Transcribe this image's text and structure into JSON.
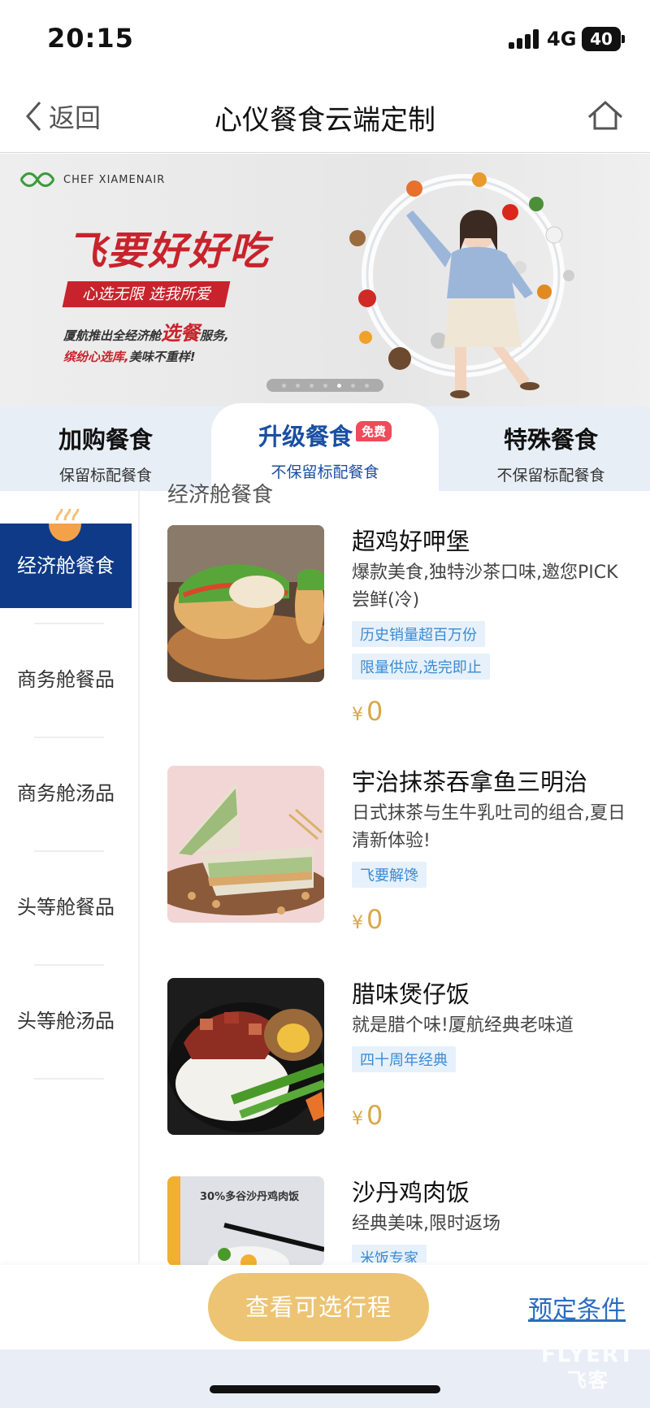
{
  "status_bar": {
    "time": "20:15",
    "network": "4G",
    "battery": "40"
  },
  "nav": {
    "back_label": "返回",
    "title": "心仪餐食云端定制"
  },
  "banner": {
    "brand": "CHEF XIAMENAIR",
    "slogan": "飞要好好吃",
    "ribbon": "心选无限 选我所爱",
    "promo_line1_prefix": "厦航推出全经济舱",
    "promo_line1_highlight": "选餐",
    "promo_line1_suffix": "服务,",
    "promo_line2_highlight": "缤纷心选库,",
    "promo_line2_suffix": "美味不重样!",
    "active_slide": 5,
    "slide_count": 7
  },
  "tabs": [
    {
      "title": "加购餐食",
      "subtitle": "保留标配餐食"
    },
    {
      "title": "升级餐食",
      "subtitle": "不保留标配餐食",
      "badge": "免费"
    },
    {
      "title": "特殊餐食",
      "subtitle": "不保留标配餐食"
    }
  ],
  "sidebar": {
    "items": [
      "经济舱餐食",
      "商务舱餐品",
      "商务舱汤品",
      "头等舱餐品",
      "头等舱汤品"
    ]
  },
  "section_title": "经济舱餐食",
  "items": [
    {
      "name": "超鸡好呷堡",
      "desc": "爆款美食,独特沙茶口味,邀您PICK尝鲜(冷)",
      "tags": [
        "历史销量超百万份",
        "限量供应,选完即止"
      ],
      "currency": "¥",
      "price": "0"
    },
    {
      "name": "宇治抹茶吞拿鱼三明治",
      "desc": "日式抹茶与生牛乳吐司的组合,夏日清新体验!",
      "tags": [
        "飞要解馋"
      ],
      "currency": "¥",
      "price": "0"
    },
    {
      "name": "腊味煲仔饭",
      "desc": "就是腊个味!厦航经典老味道",
      "tags": [
        "四十周年经典"
      ],
      "currency": "¥",
      "price": "0"
    },
    {
      "name": "沙丹鸡肉饭",
      "desc": "经典美味,限时返场",
      "tags": [
        "米饭专家"
      ],
      "image_text": "30%多谷沙丹鸡肉饭"
    }
  ],
  "bottom": {
    "primary_button": "查看可选行程",
    "condition_link": "预定条件"
  },
  "watermark": {
    "line1": "FLYERT",
    "line2": "飞客"
  },
  "colors": {
    "primary_blue": "#0e3a87",
    "tab_active_text": "#1a4fa3",
    "price_gold": "#d9a84a",
    "button_gold": "#ecc474",
    "tag_bg": "#e7f1fb",
    "tag_text": "#3a8ad3",
    "badge_red": "#f04b5a",
    "banner_red": "#c8232c"
  }
}
